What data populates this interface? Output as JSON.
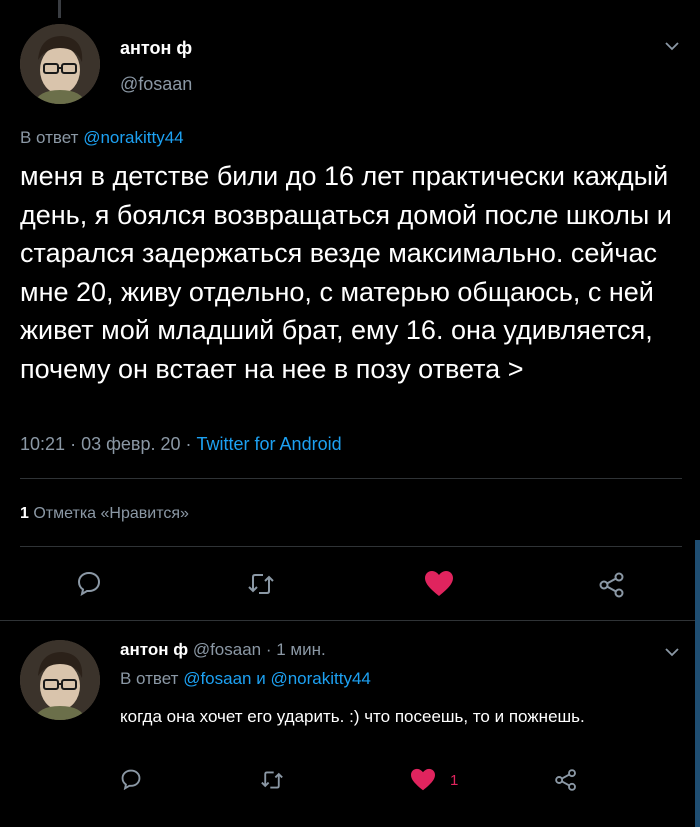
{
  "tweet": {
    "author_name": "антон ф",
    "author_handle": "@fosaan",
    "reply_prefix": "В ответ",
    "reply_to": "@norakitty44",
    "text": "меня в детстве били до 16 лет практически каждый день, я боялся возвращаться домой после школы и старался задержаться везде максимально. сейчас мне 20, живу отдельно, с матерью общаюсь, с ней живет мой младший брат, ему 16. она удивляется, почему он встает на нее в позу ответа >",
    "time": "10:21",
    "date": "03 февр. 20",
    "source": "Twitter for Android",
    "likes_count": "1",
    "likes_label": "Отметка «Нравится»",
    "icons": [
      "reply-icon",
      "retweet-icon",
      "heart-icon",
      "share-icon"
    ]
  },
  "reply": {
    "author_name": "антон ф",
    "author_handle": "@fosaan",
    "time_ago": "1 мин.",
    "reply_prefix": "В ответ",
    "reply_to_1": "@fosaan",
    "conjunction": "и",
    "reply_to_2": "@norakitty44",
    "text": "когда она хочет его ударить. :) что посеешь, то и пожнешь.",
    "like_count": "1",
    "icons": [
      "reply-icon",
      "retweet-icon",
      "heart-icon",
      "share-icon"
    ]
  },
  "colors": {
    "background": "#000000",
    "link": "#1da1f2",
    "muted": "#8b98a5",
    "like": "#e0245e",
    "divider": "#2f3336"
  }
}
